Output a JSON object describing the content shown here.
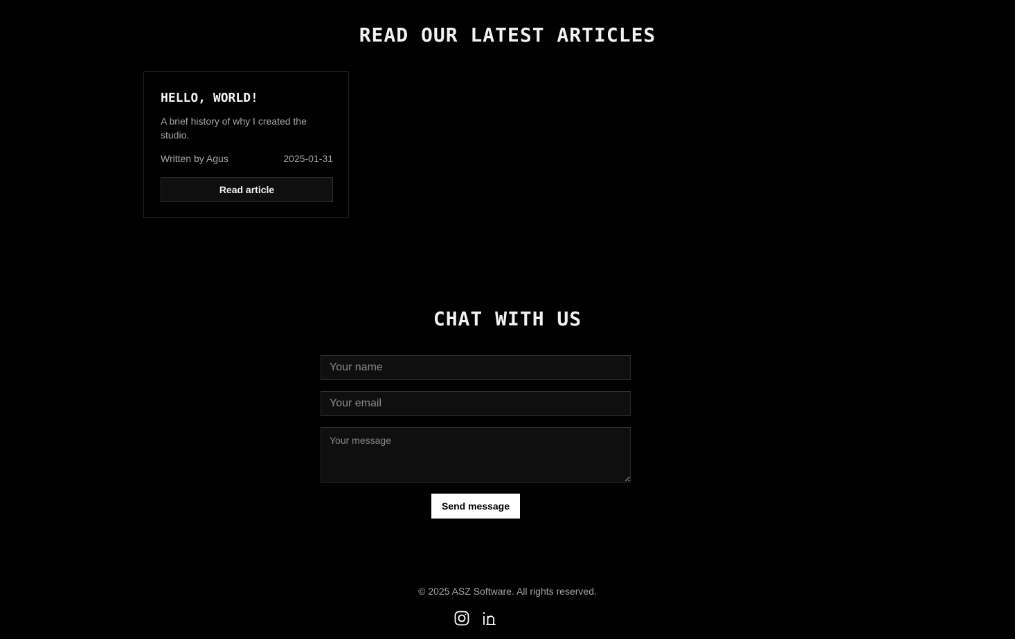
{
  "articles_section": {
    "title": "READ OUR LATEST ARTICLES",
    "articles": [
      {
        "title": "HELLO, WORLD!",
        "excerpt": "A brief history of why I created the studio.",
        "author": "Written by Agus",
        "date": "2025-01-31",
        "button_label": "Read article"
      }
    ]
  },
  "contact_section": {
    "title": "CHAT WITH US",
    "name_placeholder": "Your name",
    "email_placeholder": "Your email",
    "message_placeholder": "Your message",
    "submit_label": "Send message"
  },
  "footer": {
    "copyright": "© 2025 ASZ Software. All rights reserved.",
    "social_icons": [
      "instagram-icon",
      "linkedin-icon"
    ]
  },
  "colors": {
    "background": "#000000",
    "text": "#f2f2f2",
    "muted_text": "#a6a6a6",
    "field_background": "#0f0f0f",
    "border": "#2e2e2e",
    "primary_button_bg": "#ffffff",
    "primary_button_text": "#000000"
  }
}
